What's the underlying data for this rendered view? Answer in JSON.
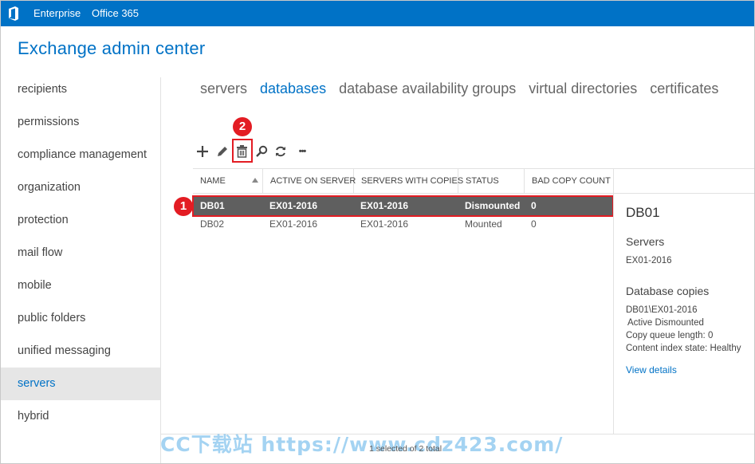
{
  "topbar": {
    "enterprise": "Enterprise",
    "office365": "Office 365",
    "color": "#0072c6"
  },
  "app": {
    "title": "Exchange admin center"
  },
  "sidebar": {
    "items": [
      {
        "label": "recipients"
      },
      {
        "label": "permissions"
      },
      {
        "label": "compliance management"
      },
      {
        "label": "organization"
      },
      {
        "label": "protection"
      },
      {
        "label": "mail flow"
      },
      {
        "label": "mobile"
      },
      {
        "label": "public folders"
      },
      {
        "label": "unified messaging"
      },
      {
        "label": "servers",
        "selected": true
      },
      {
        "label": "hybrid"
      }
    ]
  },
  "tabs": [
    {
      "label": "servers"
    },
    {
      "label": "databases",
      "active": true
    },
    {
      "label": "database availability groups"
    },
    {
      "label": "virtual directories"
    },
    {
      "label": "certificates"
    }
  ],
  "toolbar": {
    "icons": [
      "add-icon",
      "edit-icon",
      "delete-icon",
      "search-icon",
      "refresh-icon",
      "more-icon"
    ],
    "more_label": "•••"
  },
  "markers": {
    "row": "1",
    "delete": "2",
    "color": "#e31c23"
  },
  "table": {
    "columns": [
      "NAME",
      "ACTIVE ON SERVER",
      "SERVERS WITH COPIES",
      "STATUS",
      "BAD COPY COUNT"
    ],
    "rows": [
      {
        "name": "DB01",
        "active": "EX01-2016",
        "servers": "EX01-2016",
        "status": "Dismounted",
        "bad": "0",
        "selected": true
      },
      {
        "name": "DB02",
        "active": "EX01-2016",
        "servers": "EX01-2016",
        "status": "Mounted",
        "bad": "0",
        "selected": false
      }
    ]
  },
  "details": {
    "title": "DB01",
    "servers_heading": "Servers",
    "servers_value": "EX01-2016",
    "copies_heading": "Database copies",
    "copy_name": "DB01\\EX01-2016",
    "copy_status": "Active Dismounted",
    "copy_queue": "Copy queue length:  0",
    "content_index": "Content index state:  Healthy",
    "view_details": "View details"
  },
  "status_bar": {
    "text": "1 selected of 2 total"
  },
  "watermark": {
    "text": "CC下载站 https://www.cdz423.com/"
  }
}
